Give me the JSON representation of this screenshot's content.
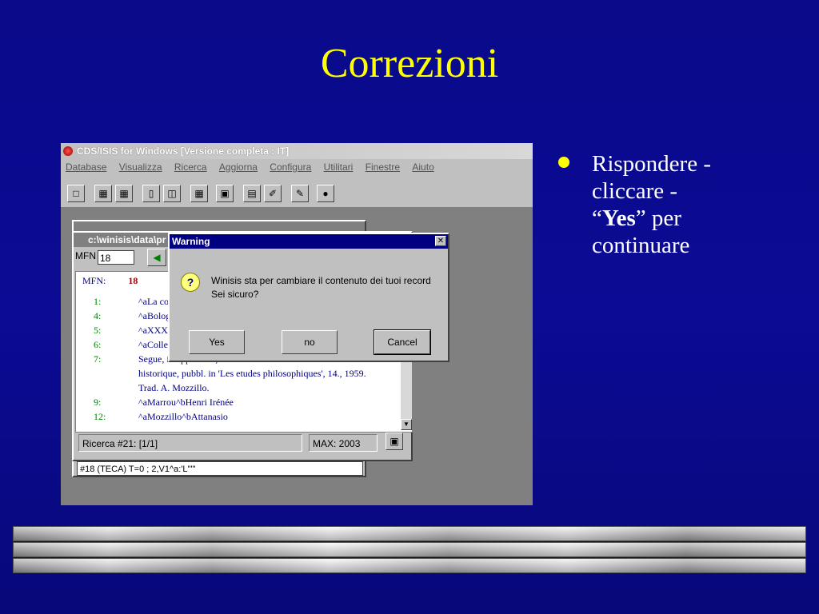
{
  "slide": {
    "title": "Correzioni",
    "bullet": {
      "prefix": "Rispondere - cliccare - “",
      "bold": "Yes",
      "suffix": "” per continuare"
    },
    "accent": "#ffff00",
    "background": "#0a0a8a"
  },
  "app": {
    "title": "CDS/ISIS for Windows [Versione completa : IT]",
    "menu": [
      "Database",
      "Visualizza",
      "Ricerca",
      "Aggiorna",
      "Configura",
      "Utilitari",
      "Finestre",
      "Aiuto"
    ]
  },
  "record_window": {
    "title": "c:\\winisis\\data\\pr",
    "mfn_label": "MFN",
    "mfn_value": "18",
    "head_label": "MFN:",
    "head_value": "18",
    "lines": [
      {
        "n": "1:",
        "c": "^aLa co"
      },
      {
        "n": "4:",
        "c": "^aBolog"
      },
      {
        "n": "5:",
        "c": "^aXXX"
      },
      {
        "n": "6:",
        "c": "^aColle"
      },
      {
        "n": "7:",
        "c": "Segue, in appendice, la trad. italiana dello scritto: La foi"
      },
      {
        "n": "",
        "c": "historique, pubbl. in 'Les etudes philosophiques', 14., 1959."
      },
      {
        "n": "",
        "c": "Trad. A. Mozzillo."
      },
      {
        "n": "9:",
        "c": "^aMarrou^bHenri Irénée"
      },
      {
        "n": "12:",
        "c": "^aMozzillo^bAttanasio"
      }
    ],
    "status": "Ricerca #21: [1/1]",
    "max": "MAX: 2003",
    "command": "#18 (TECA) T=0 ; 2,V1^a:'L'\"\""
  },
  "dialog": {
    "title": "Warning",
    "message1": "Winisis sta per cambiare il contenuto dei tuoi record",
    "message2": "Sei sicuro?",
    "yes": "Yes",
    "no": "no",
    "cancel": "Cancel"
  }
}
